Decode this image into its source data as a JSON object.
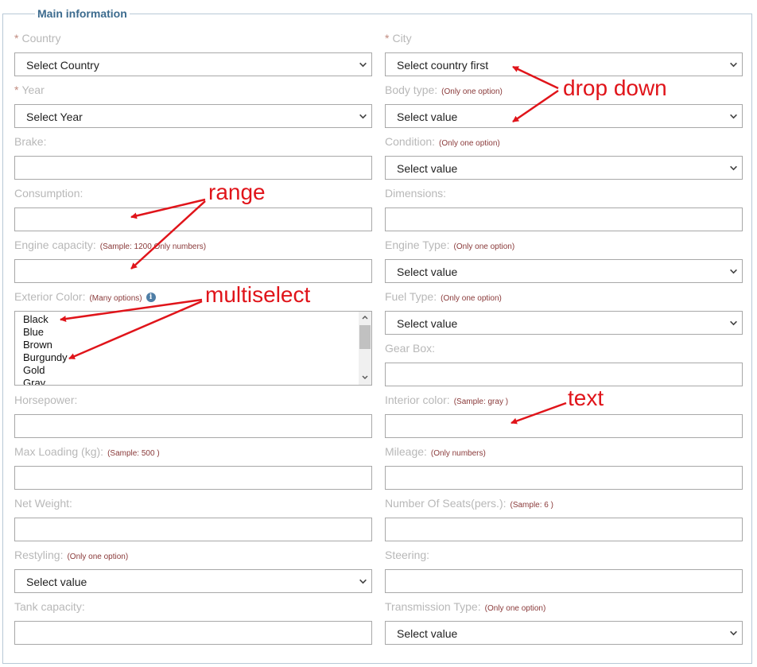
{
  "legend": "Main information",
  "labels": {
    "country": "Country",
    "year": "Year",
    "brake": "Brake:",
    "consumption": "Consumption:",
    "engine_capacity": "Engine capacity:",
    "exterior_color": "Exterior Color:",
    "horsepower": "Horsepower:",
    "max_loading": "Max Loading (kg):",
    "net_weight": "Net Weight:",
    "restyling": "Restyling:",
    "tank_capacity": "Tank capacity:",
    "city": "City",
    "body_type": "Body type:",
    "condition": "Condition:",
    "dimensions": "Dimensions:",
    "engine_type": "Engine Type:",
    "fuel_type": "Fuel Type:",
    "gear_box": "Gear Box:",
    "interior_color": "Interior color:",
    "mileage": "Mileage:",
    "number_of_seats": "Number Of Seats(pers.):",
    "steering": "Steering:",
    "transmission_type": "Transmission Type:"
  },
  "required_mark": "*",
  "hints": {
    "engine_capacity": "(Sample: 1200 Only numbers)",
    "exterior_color": "(Many options)",
    "max_loading": "(Sample: 500 )",
    "restyling": "(Only one option)",
    "body_type": "(Only one option)",
    "condition": "(Only one option)",
    "engine_type": "(Only one option)",
    "fuel_type": "(Only one option)",
    "interior_color": "(Sample: gray )",
    "mileage": "(Only numbers)",
    "number_of_seats": "(Sample: 6 )",
    "transmission_type": "(Only one option)"
  },
  "selects": {
    "country": "Select Country",
    "year": "Select Year",
    "restyling": "Select value",
    "city": "Select country first",
    "body_type": "Select value",
    "condition": "Select value",
    "engine_type": "Select value",
    "fuel_type": "Select value",
    "transmission_type": "Select value"
  },
  "exterior_color_options": [
    "Black",
    "Blue",
    "Brown",
    "Burgundy",
    "Gold",
    "Gray"
  ],
  "annotations": {
    "drop_down": "drop down",
    "range": "range",
    "multiselect": "multiselect",
    "text": "text"
  },
  "colors": {
    "accent": "#3c6b8e",
    "annotation": "#e0141a",
    "label": "#b8b8b8",
    "hint": "#8a3a3a"
  },
  "icons": {
    "info": "info-icon",
    "chevron": "chevron-down-icon"
  }
}
